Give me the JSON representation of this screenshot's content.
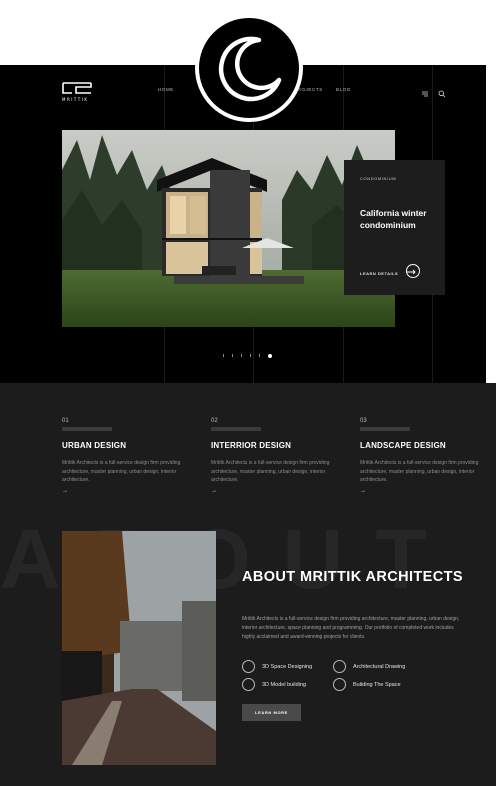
{
  "theme": {
    "accent": "#ffffff",
    "bg_dark": "#000000",
    "bg_section": "#1c1c1c"
  },
  "toggle": {
    "icon": "moon-icon"
  },
  "brand": {
    "name": "MRITTIK"
  },
  "nav": {
    "items": [
      "HOME",
      "",
      "",
      "PROJECTS",
      "BLOG"
    ]
  },
  "header_icons": [
    "menu-icon",
    "search-icon"
  ],
  "hero": {
    "category": "CONDOMINIUM",
    "title": "California winter condominium",
    "cta": "LEARN DETAILS",
    "slides": 6,
    "active_slide": 6
  },
  "services": [
    {
      "num": "01",
      "title": "URBAN DESIGN",
      "desc": "Mrittik Architects is a full-service design firm providing architecture, master planning, urban design, interior architecture."
    },
    {
      "num": "02",
      "title": "INTERRIOR DESIGN",
      "desc": "Mrittik Architects is a full-service design firm providing architecture, master planning, urban design, interior architecture."
    },
    {
      "num": "03",
      "title": "LANDSCAPE DESIGN",
      "desc": "Mrittik Architects is a full-service design firm providing architecture, master planning, urban design, interior architecture."
    }
  ],
  "about": {
    "bg_word": "ABOUT",
    "title": "ABOUT MRITTIK ARCHITECTS",
    "desc": "Mrittik Architects is a full-service design firm providing architecture, master planning, urban design, interior architecture, space planning and programming. Our portfolio of completed work includes highly acclaimed and award-winning projects for clients.",
    "features": [
      {
        "label": "3D Space Designing",
        "icon": "cube-icon"
      },
      {
        "label": "Architectural Drawing",
        "icon": "compass-icon"
      },
      {
        "label": "3D Model building",
        "icon": "box-icon"
      },
      {
        "label": "Building The Space",
        "icon": "building-icon"
      }
    ],
    "cta": "LEARN MORE"
  }
}
